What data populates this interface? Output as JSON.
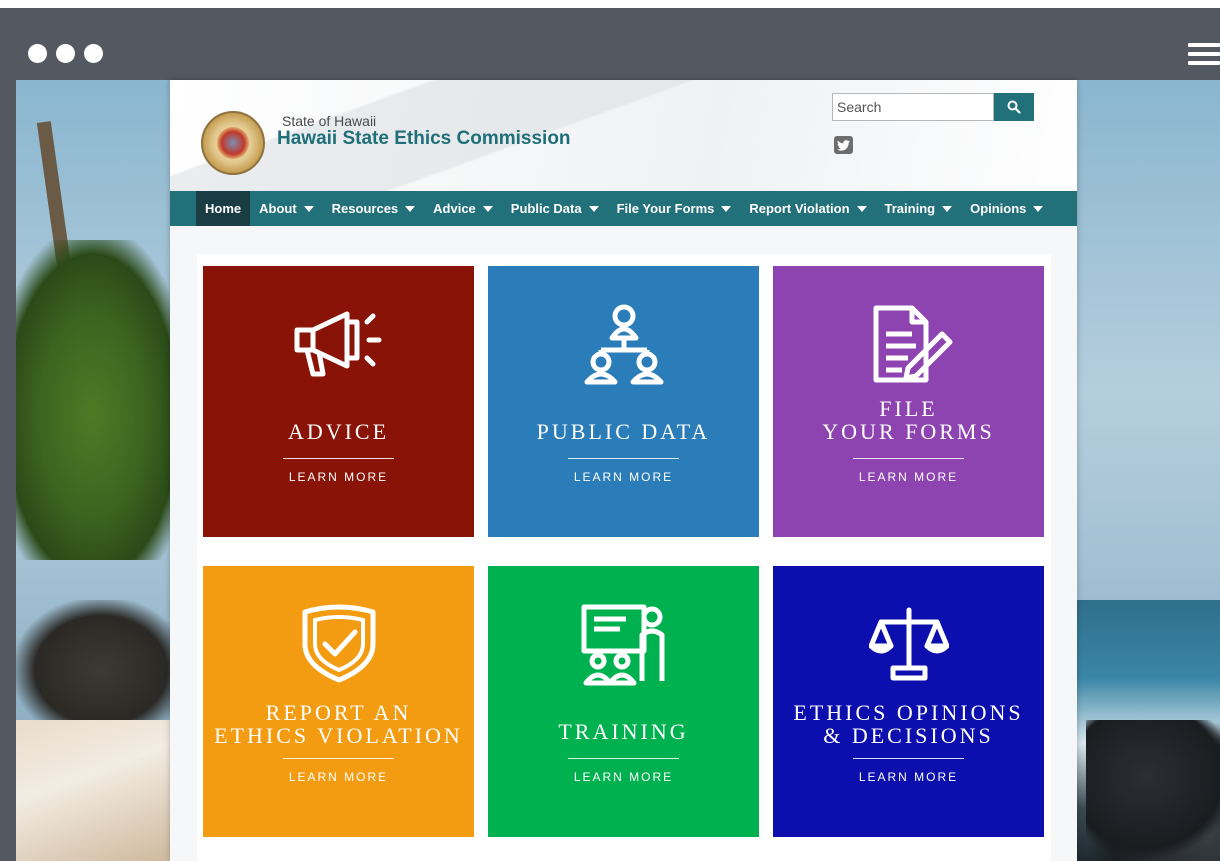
{
  "site": {
    "state_name": "State of Hawaii",
    "commission_name": "Hawaii State Ethics Commission"
  },
  "search": {
    "placeholder": "Search",
    "button_icon": "search-icon"
  },
  "social": {
    "twitter_icon": "twitter-icon"
  },
  "nav": {
    "items": [
      {
        "label": "Home",
        "dropdown": false
      },
      {
        "label": "About",
        "dropdown": true
      },
      {
        "label": "Resources",
        "dropdown": true
      },
      {
        "label": "Advice",
        "dropdown": true
      },
      {
        "label": "Public Data",
        "dropdown": true
      },
      {
        "label": "File Your Forms",
        "dropdown": true
      },
      {
        "label": "Report Violation",
        "dropdown": true
      },
      {
        "label": "Training",
        "dropdown": true
      },
      {
        "label": "Opinions",
        "dropdown": true
      }
    ]
  },
  "tiles": [
    {
      "title_lines": [
        "ADVICE"
      ],
      "more": "LEARN MORE",
      "color": "#8a1308",
      "icon": "megaphone-icon"
    },
    {
      "title_lines": [
        "PUBLIC DATA"
      ],
      "more": "LEARN MORE",
      "color": "#2b7dba",
      "icon": "network-people-icon"
    },
    {
      "title_lines": [
        "FILE",
        "YOUR FORMS"
      ],
      "more": "LEARN MORE",
      "color": "#8e44b0",
      "icon": "document-pen-icon"
    },
    {
      "title_lines": [
        "REPORT AN",
        "ETHICS VIOLATION"
      ],
      "more": "LEARN MORE",
      "color": "#f39c12",
      "icon": "shield-check-icon"
    },
    {
      "title_lines": [
        "TRAINING"
      ],
      "more": "LEARN MORE",
      "color": "#00b14f",
      "icon": "presentation-icon"
    },
    {
      "title_lines": [
        "ETHICS OPINIONS",
        "& DECISIONS"
      ],
      "more": "LEARN MORE",
      "color": "#0c0fad",
      "icon": "scales-icon"
    }
  ],
  "colors": {
    "nav_bg": "#22707a",
    "nav_active": "#1a3d44",
    "chrome": "#545861",
    "brand_text": "#1f6f78"
  }
}
